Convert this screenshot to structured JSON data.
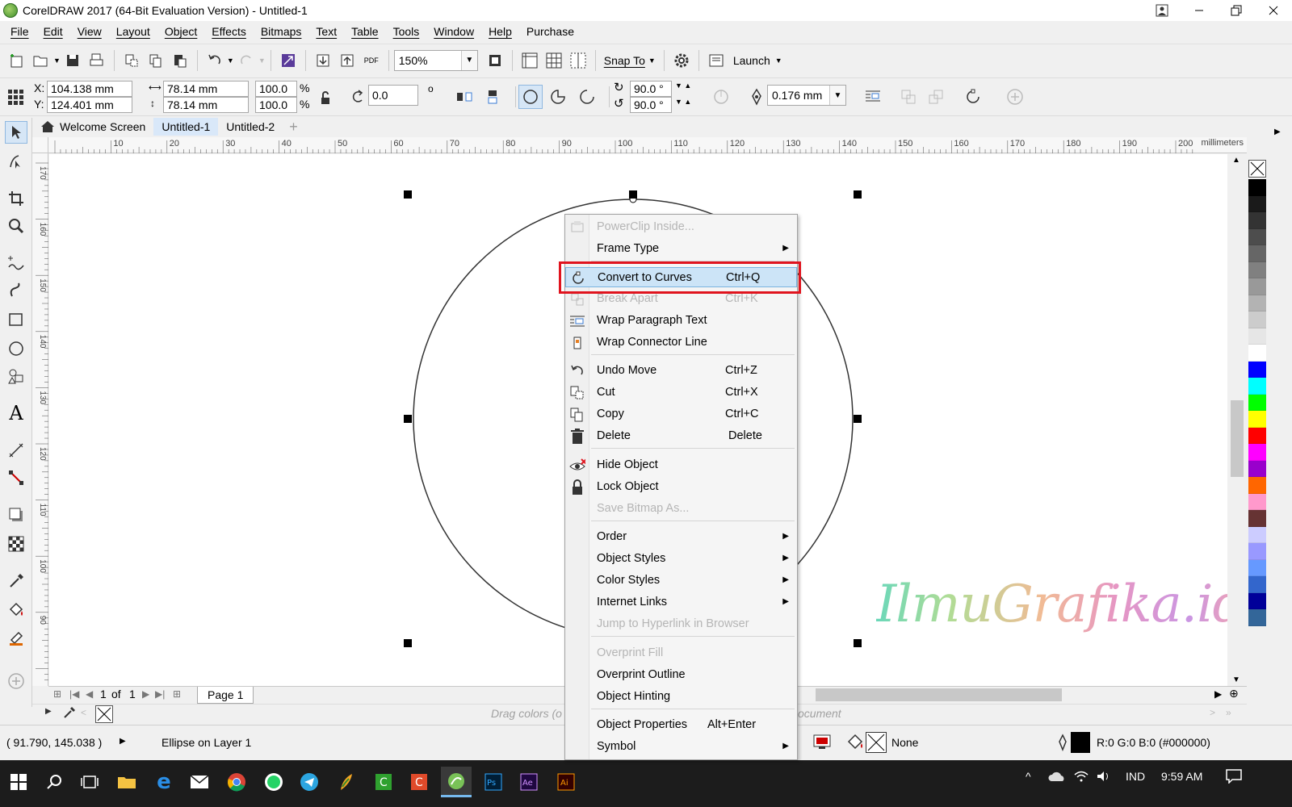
{
  "titlebar": {
    "title": "CorelDRAW 2017 (64-Bit Evaluation Version) - Untitled-1"
  },
  "menubar": {
    "items": [
      "File",
      "Edit",
      "View",
      "Layout",
      "Object",
      "Effects",
      "Bitmaps",
      "Text",
      "Table",
      "Tools",
      "Window",
      "Help",
      "Purchase"
    ]
  },
  "toolbar": {
    "zoom": "150%",
    "snap_to": "Snap To",
    "launch": "Launch"
  },
  "property_bar": {
    "x_label": "X:",
    "y_label": "Y:",
    "x_value": "104.138 mm",
    "y_value": "124.401 mm",
    "width": "78.14 mm",
    "height": "78.14 mm",
    "scale_w": "100.0",
    "scale_h": "100.0",
    "percent": "%",
    "rotation": "0.0",
    "degree": "o",
    "start_angle": "90.0 °",
    "end_angle": "90.0 °",
    "outline_width": "0.176 mm"
  },
  "tabs": [
    "Welcome Screen",
    "Untitled-1",
    "Untitled-2"
  ],
  "ruler": {
    "unit": "millimeters",
    "h_ticks": [
      "10",
      "20",
      "30",
      "40",
      "50",
      "60",
      "70",
      "80",
      "90",
      "100",
      "110",
      "120",
      "130",
      "140",
      "150",
      "160",
      "170",
      "180",
      "190",
      "200"
    ],
    "v_ticks": [
      "170",
      "160",
      "150",
      "140",
      "130",
      "120",
      "110",
      "100",
      "90"
    ]
  },
  "page_nav": {
    "current": "1",
    "of_label": "of",
    "total": "1",
    "page_tab": "Page 1"
  },
  "color_bar": {
    "hint": "Drag colors (o",
    "hint_end": "ocument"
  },
  "context_menu": {
    "items": [
      {
        "label": "PowerClip Inside...",
        "shortcut": "",
        "disabled": true,
        "icon": "powerclip-icon"
      },
      {
        "label": "Frame Type",
        "shortcut": "",
        "submenu": true,
        "icon": ""
      },
      {
        "label": "Convert to Curves",
        "shortcut": "Ctrl+Q",
        "highlighted": true,
        "icon": "convert-curves-icon"
      },
      {
        "label": "Break Apart",
        "shortcut": "Ctrl+K",
        "disabled": true,
        "icon": "break-apart-icon"
      },
      {
        "label": "Wrap Paragraph Text",
        "shortcut": "",
        "icon": "wrap-text-icon"
      },
      {
        "label": "Wrap Connector Line",
        "shortcut": "",
        "icon": "wrap-connector-icon"
      },
      {
        "label": "Undo Move",
        "shortcut": "Ctrl+Z",
        "icon": "undo-icon"
      },
      {
        "label": "Cut",
        "shortcut": "Ctrl+X",
        "icon": "cut-icon"
      },
      {
        "label": "Copy",
        "shortcut": "Ctrl+C",
        "icon": "copy-icon"
      },
      {
        "label": "Delete",
        "shortcut": "Delete",
        "icon": "trash-icon"
      },
      {
        "label": "Hide Object",
        "shortcut": "",
        "icon": "hide-eye-icon"
      },
      {
        "label": "Lock Object",
        "shortcut": "",
        "icon": "lock-icon"
      },
      {
        "label": "Save Bitmap As...",
        "shortcut": "",
        "disabled": true,
        "icon": ""
      },
      {
        "label": "Order",
        "shortcut": "",
        "submenu": true,
        "icon": ""
      },
      {
        "label": "Object Styles",
        "shortcut": "",
        "submenu": true,
        "icon": ""
      },
      {
        "label": "Color Styles",
        "shortcut": "",
        "submenu": true,
        "icon": ""
      },
      {
        "label": "Internet Links",
        "shortcut": "",
        "submenu": true,
        "icon": ""
      },
      {
        "label": "Jump to Hyperlink in Browser",
        "shortcut": "",
        "disabled": true,
        "icon": ""
      },
      {
        "label": "Overprint Fill",
        "shortcut": "",
        "disabled": true,
        "icon": ""
      },
      {
        "label": "Overprint Outline",
        "shortcut": "",
        "icon": ""
      },
      {
        "label": "Object Hinting",
        "shortcut": "",
        "icon": ""
      },
      {
        "label": "Object Properties",
        "shortcut": "Alt+Enter",
        "icon": ""
      },
      {
        "label": "Symbol",
        "shortcut": "",
        "submenu": true,
        "icon": ""
      }
    ]
  },
  "statusbar": {
    "coords": "( 91.790, 145.038 )",
    "object": "Ellipse on Layer 1",
    "fill": "None",
    "outline_color": "R:0 G:0 B:0 (#000000)"
  },
  "watermark": "IlmuGrafika.id",
  "taskbar": {
    "lang": "IND",
    "time": "9:59 AM"
  },
  "palette": [
    "#000000",
    "#1a1a1a",
    "#333333",
    "#4d4d4d",
    "#666666",
    "#808080",
    "#999999",
    "#b3b3b3",
    "#cccccc",
    "#e6e6e6",
    "#ffffff",
    "#0000ff",
    "#00ffff",
    "#00ff00",
    "#ffff00",
    "#ff0000",
    "#ff00ff",
    "#9900cc",
    "#ff6600",
    "#ff99cc",
    "#663333",
    "#ccccff",
    "#9999ff",
    "#6699ff",
    "#3366cc",
    "#000099",
    "#336699"
  ],
  "colors": {
    "highlight": "#cce4f7",
    "red_box": "#e0141e",
    "active_tab": "#d9e8f9"
  }
}
